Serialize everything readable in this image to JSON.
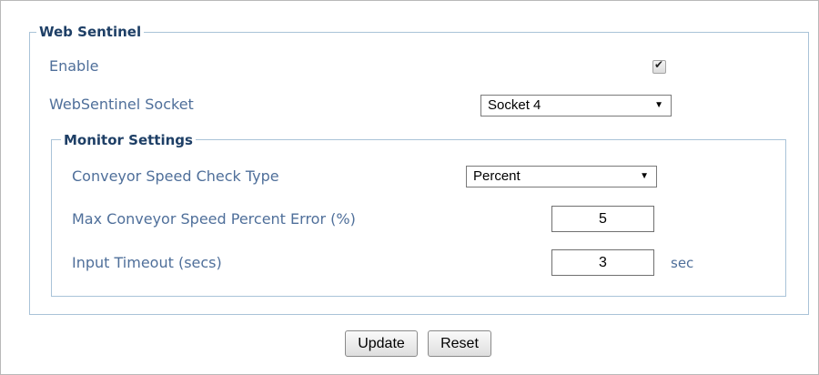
{
  "web_sentinel": {
    "legend": "Web Sentinel",
    "enable_label": "Enable",
    "enable_checked": true,
    "socket_label": "WebSentinel Socket",
    "socket_value": "Socket 4"
  },
  "monitor_settings": {
    "legend": "Monitor Settings",
    "check_type_label": "Conveyor Speed Check Type",
    "check_type_value": "Percent",
    "max_error_label": "Max Conveyor Speed Percent Error (%)",
    "max_error_value": "5",
    "input_timeout_label": "Input Timeout (secs)",
    "input_timeout_value": "3",
    "input_timeout_unit": "sec"
  },
  "buttons": {
    "update": "Update",
    "reset": "Reset"
  },
  "icons": {
    "checkbox": "checkmark-icon",
    "dropdown": "chevron-down-icon"
  }
}
